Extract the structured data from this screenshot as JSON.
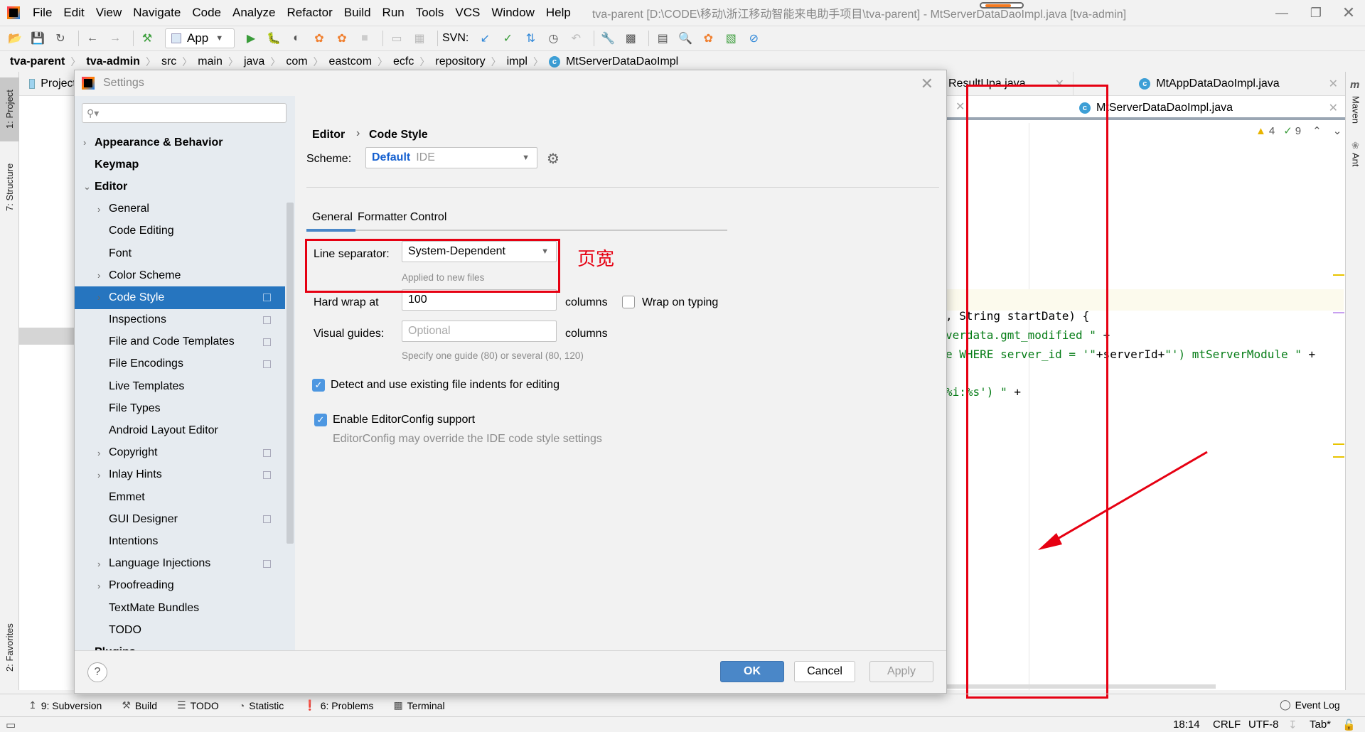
{
  "window": {
    "title": "tva-parent [D:\\CODE\\移动\\浙江移动智能来电助手项目\\tva-parent] - MtServerDataDaoImpl.java [tva-admin]",
    "menu": [
      "File",
      "Edit",
      "View",
      "Navigate",
      "Code",
      "Analyze",
      "Refactor",
      "Build",
      "Run",
      "Tools",
      "VCS",
      "Window",
      "Help"
    ]
  },
  "toolbar": {
    "run_config": "App",
    "svn_label": "SVN:"
  },
  "breadcrumb": [
    "tva-parent",
    "tva-admin",
    "src",
    "main",
    "java",
    "com",
    "eastcom",
    "ecfc",
    "repository",
    "impl",
    "MtServerDataDaoImpl"
  ],
  "left_stripe": {
    "project": "1: Project",
    "structure": "7: Structure",
    "favorites": "2: Favorites"
  },
  "right_stripe": {
    "maven": "Maven",
    "ant": "Ant"
  },
  "project_panel": {
    "title": "Project"
  },
  "editor": {
    "tabs_row1": [
      {
        "label": "ResultUpa.java"
      },
      {
        "label": "MtAppDataDaoImpl.java"
      }
    ],
    "tabs_row2": [
      {
        "label": "MtServerDataDaoImpl.java",
        "active": true
      }
    ],
    "warnings": "4",
    "weak_warnings": "9",
    "code_lines": [
      {
        "plain": ", String startDate) {",
        "str": ""
      },
      {
        "plain": "",
        "str": "verdata.gmt_modified \" ",
        "tail": "+"
      },
      {
        "plain": "",
        "str": "e WHERE server_id = '\"",
        "tail": "+serverId+",
        "str2": "\"') mtServerModule \" ",
        "tail2": "+"
      },
      {
        "plain": "",
        "str": "%i:%s') \" ",
        "tail": "+"
      }
    ]
  },
  "settings": {
    "title": "Settings",
    "search_placeholder": "",
    "tree": [
      {
        "label": "Appearance & Behavior",
        "level": 0,
        "bold": true,
        "arrow": "›"
      },
      {
        "label": "Keymap",
        "level": 0,
        "bold": true
      },
      {
        "label": "Editor",
        "level": 0,
        "bold": true,
        "arrow": "⌄"
      },
      {
        "label": "General",
        "level": 1,
        "arrow": "›"
      },
      {
        "label": "Code Editing",
        "level": 1
      },
      {
        "label": "Font",
        "level": 1
      },
      {
        "label": "Color Scheme",
        "level": 1,
        "arrow": "›"
      },
      {
        "label": "Code Style",
        "level": 1,
        "arrow": "›",
        "selected": true,
        "project": true
      },
      {
        "label": "Inspections",
        "level": 1,
        "project": true
      },
      {
        "label": "File and Code Templates",
        "level": 1,
        "project": true
      },
      {
        "label": "File Encodings",
        "level": 1,
        "project": true
      },
      {
        "label": "Live Templates",
        "level": 1
      },
      {
        "label": "File Types",
        "level": 1
      },
      {
        "label": "Android Layout Editor",
        "level": 1
      },
      {
        "label": "Copyright",
        "level": 1,
        "arrow": "›",
        "project": true
      },
      {
        "label": "Inlay Hints",
        "level": 1,
        "arrow": "›",
        "project": true
      },
      {
        "label": "Emmet",
        "level": 1
      },
      {
        "label": "GUI Designer",
        "level": 1,
        "project": true
      },
      {
        "label": "Intentions",
        "level": 1
      },
      {
        "label": "Language Injections",
        "level": 1,
        "arrow": "›",
        "project": true
      },
      {
        "label": "Proofreading",
        "level": 1,
        "arrow": "›"
      },
      {
        "label": "TextMate Bundles",
        "level": 1
      },
      {
        "label": "TODO",
        "level": 1
      },
      {
        "label": "Plugins",
        "level": 0,
        "bold": true
      }
    ],
    "breadcrumb_parent": "Editor",
    "breadcrumb_current": "Code Style",
    "scheme_label": "Scheme:",
    "scheme_name": "Default",
    "scheme_type": "IDE",
    "tabs": [
      "General",
      "Formatter Control"
    ],
    "active_tab": "General",
    "line_separator_label": "Line separator:",
    "line_separator_value": "System-Dependent",
    "line_separator_hint": "Applied to new files",
    "hard_wrap_label": "Hard wrap at",
    "hard_wrap_value": "100",
    "hard_wrap_unit": "columns",
    "wrap_on_typing_label": "Wrap on typing",
    "wrap_on_typing_checked": false,
    "visual_guides_label": "Visual guides:",
    "visual_guides_placeholder": "Optional",
    "visual_guides_unit": "columns",
    "visual_guides_hint": "Specify one guide (80) or several (80, 120)",
    "detect_indents_label": "Detect and use existing file indents for editing",
    "detect_indents_checked": true,
    "editorconfig_label": "Enable EditorConfig support",
    "editorconfig_checked": true,
    "editorconfig_hint": "EditorConfig may override the IDE code style settings",
    "buttons": {
      "ok": "OK",
      "cancel": "Cancel",
      "apply": "Apply",
      "help": "?"
    }
  },
  "annotation": {
    "text": "页宽",
    "color": "#e60012"
  },
  "tool_windows": [
    {
      "label": "9: Subversion",
      "icon": "subversion-icon"
    },
    {
      "label": "Build",
      "icon": "hammer-icon"
    },
    {
      "label": "TODO",
      "icon": "list-icon"
    },
    {
      "label": "Statistic",
      "icon": "pie-icon"
    },
    {
      "label": "6: Problems",
      "icon": "problems-icon"
    },
    {
      "label": "Terminal",
      "icon": "terminal-icon"
    }
  ],
  "event_log": "Event Log",
  "status": {
    "position": "18:14",
    "line_ending": "CRLF",
    "encoding": "UTF-8",
    "indent": "Tab*"
  },
  "colors": {
    "accent": "#2675bf",
    "ok_button": "#4a87c8",
    "annotation_red": "#e60012",
    "sidebar_bg": "#e6ebf0"
  }
}
